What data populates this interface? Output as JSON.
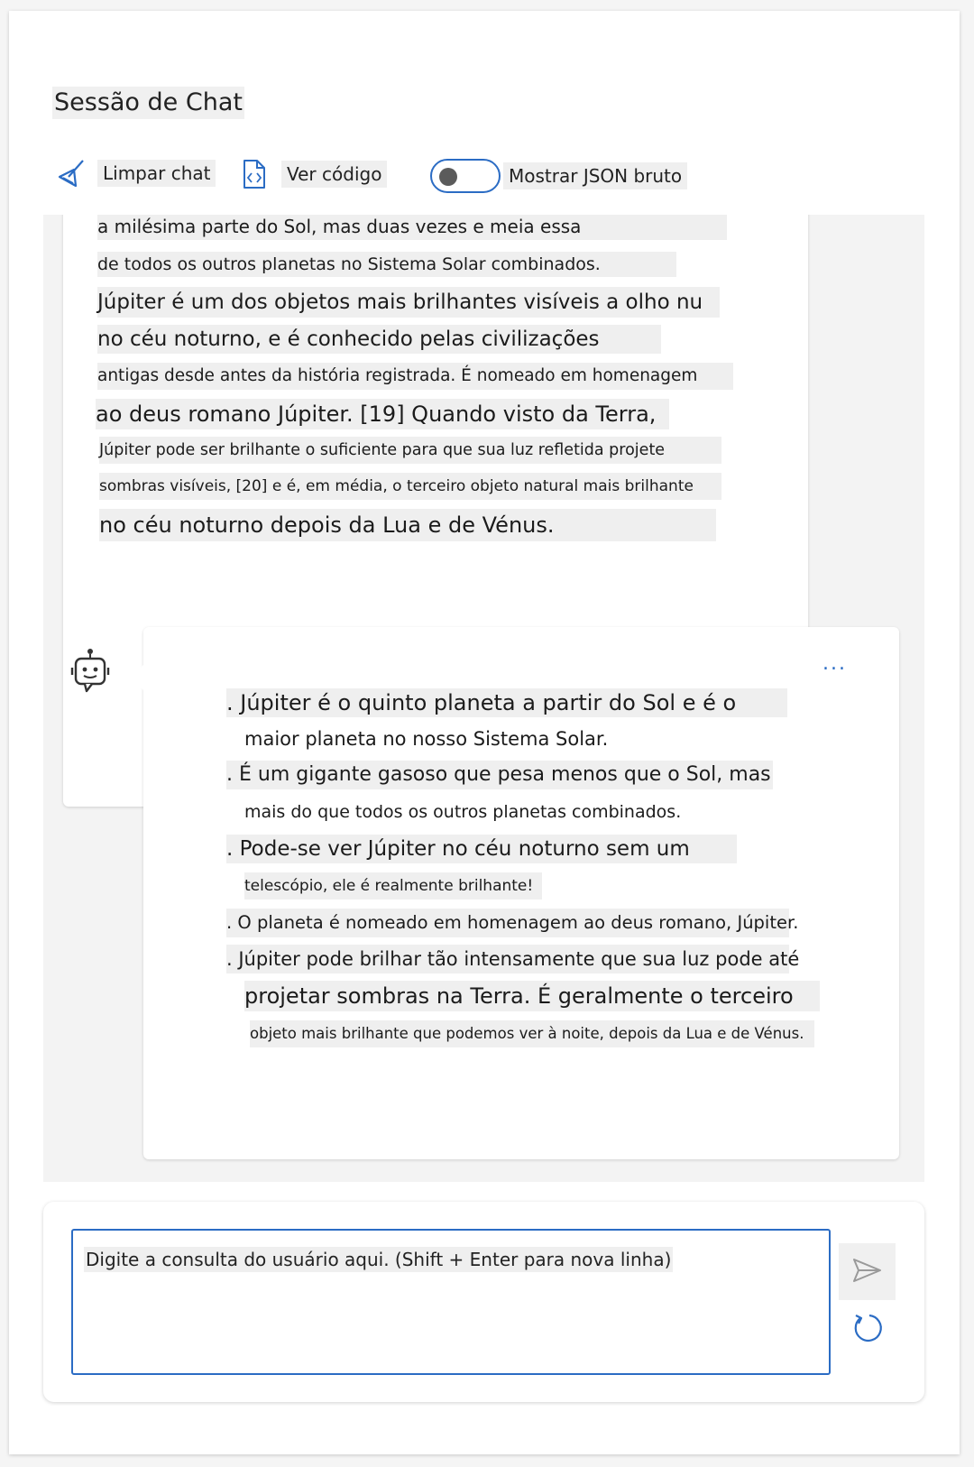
{
  "header": {
    "title": "Sessão de Chat"
  },
  "toolbar": {
    "clear_label": "Limpar chat",
    "code_label": "Ver código",
    "json_toggle_label": "Mostrar JSON bruto",
    "json_toggle_on": false
  },
  "messages": {
    "user": {
      "lines": [
        "a milésima parte do Sol, mas duas vezes e meia essa",
        "de todos os outros planetas no Sistema Solar combinados.",
        "Júpiter é um dos objetos mais brilhantes visíveis a olho nu",
        "no céu noturno, e é conhecido pelas civilizações",
        "antigas desde antes da história registrada. É nomeado em homenagem",
        "ao deus romano Júpiter. [19] Quando visto da Terra,",
        "Júpiter pode ser brilhante o suficiente para que sua luz refletida projete",
        "sombras visíveis, [20] e é, em média, o terceiro objeto natural mais brilhante",
        "no céu noturno depois da Lua e de Vénus."
      ]
    },
    "assistant": {
      "more_label": "...",
      "lines": [
        ". Júpiter é o quinto planeta a partir do Sol e é o",
        "maior planeta no nosso Sistema Solar.",
        ". É um gigante gasoso que pesa menos que o Sol, mas",
        "mais do que todos os outros planetas combinados.",
        ". Pode-se ver Júpiter no céu noturno sem um",
        "telescópio, ele é realmente brilhante!",
        ". O planeta é nomeado em homenagem ao deus romano, Júpiter.",
        ". Júpiter pode brilhar tão intensamente que sua luz pode até",
        "projetar sombras na Terra. É geralmente o terceiro",
        "objeto mais brilhante que podemos ver à noite, depois da Lua e de Vénus."
      ]
    }
  },
  "composer": {
    "placeholder": "Digite a consulta do usuário aqui. (Shift + Enter para nova linha)"
  },
  "colors": {
    "accent": "#2b6cc4",
    "panel_bg": "#f3f3f3"
  }
}
